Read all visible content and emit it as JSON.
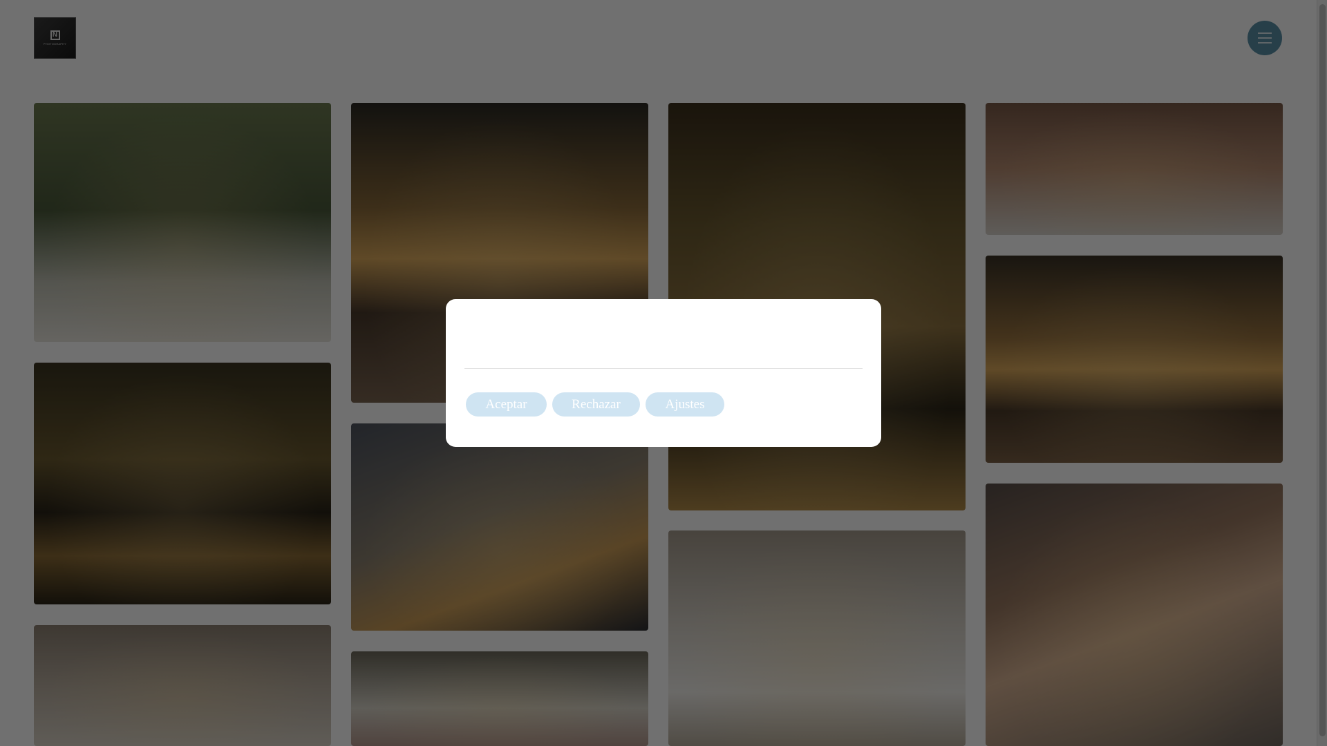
{
  "header": {
    "logo": {
      "mark": "N",
      "text": "PHOTOGRAPHY",
      "icon": "logo-icon"
    },
    "menu_button": {
      "icon": "hamburger-menu-icon",
      "color": "#5a8fa6"
    }
  },
  "gallery": {
    "tiles": [
      {
        "name": "gallery-image-wedding-couple-kiss"
      },
      {
        "name": "gallery-image-woman-on-boat-lake"
      },
      {
        "name": "gallery-image-church-arch-doorway"
      },
      {
        "name": "gallery-image-family-beach-sunset"
      },
      {
        "name": "gallery-image-modern-building-sunset"
      },
      {
        "name": "gallery-image-flower-arch"
      },
      {
        "name": "gallery-image-woman-on-rock-lake"
      },
      {
        "name": "gallery-image-bride-church-entrance"
      },
      {
        "name": "gallery-image-woman-neck-closeup"
      },
      {
        "name": "gallery-image-family-beach-sunset-2"
      },
      {
        "name": "gallery-image-woman-portrait-eyes-closed"
      }
    ]
  },
  "cookie_modal": {
    "accept_label": "Aceptar",
    "reject_label": "Rechazar",
    "settings_label": "Ajustes",
    "button_color": "#cfe4f2"
  },
  "overlay": {
    "color": "rgba(0,0,0,0.56)"
  }
}
